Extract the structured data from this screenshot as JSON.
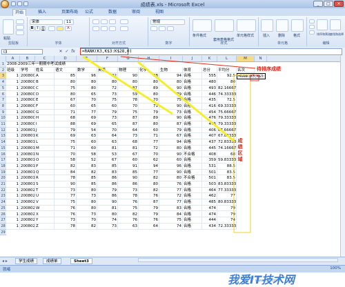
{
  "window": {
    "title": "成绩表.xls - Microsoft Excel"
  },
  "tabs": [
    "开始",
    "插入",
    "页面布局",
    "公式",
    "数据",
    "审阅",
    "视图"
  ],
  "ribbon": {
    "groups": [
      "剪贴板",
      "字体",
      "对齐方式",
      "数字",
      "样式",
      "单元格",
      "编辑"
    ],
    "buttons": [
      "粘贴",
      "条件格式",
      "套用表格格式",
      "单元格样式",
      "插入",
      "删除",
      "格式",
      "排序和筛选",
      "查找和选择"
    ],
    "font_name": "宋体",
    "font_size": "11",
    "number_format": "常规"
  },
  "formula_bar": {
    "name_box": "I3",
    "formula": "=RANK(K3,K$3:K$28,0)"
  },
  "columns": [
    "A",
    "B",
    "C",
    "D",
    "E",
    "F",
    "G",
    "H",
    "I",
    "J",
    "K",
    "L",
    "M",
    "N"
  ],
  "sheet": {
    "title": "2008-2009三年一期期中考试成绩",
    "headers": [
      "班级",
      "学号",
      "姓名",
      "语文",
      "数学",
      "英语",
      "物理",
      "化学",
      "生物",
      "体育",
      "总分",
      "平均分",
      "名次"
    ],
    "rows": [
      [
        "1",
        "2008001",
        "A",
        "85",
        "96",
        "92",
        "90",
        "98",
        "94",
        "合格",
        "555",
        "92.5",
        "=RANK(K3,K$3:K$28,0)"
      ],
      [
        "1",
        "2008002",
        "B",
        "80",
        "80",
        "80",
        "80",
        "80",
        "80",
        "合格",
        "480",
        "80",
        ""
      ],
      [
        "1",
        "2008003",
        "C",
        "75",
        "80",
        "72",
        "87",
        "89",
        "90",
        "合格",
        "493",
        "82.16667",
        ""
      ],
      [
        "1",
        "2008004",
        "D",
        "80",
        "65",
        "73",
        "59",
        "80",
        "79",
        "合格",
        "446",
        "74.33333",
        ""
      ],
      [
        "1",
        "2008005",
        "E",
        "67",
        "70",
        "75",
        "78",
        "70",
        "75",
        "合格",
        "435",
        "72.5",
        ""
      ],
      [
        "1",
        "2008006",
        "F",
        "60",
        "65",
        "60",
        "70",
        "71",
        "90",
        "合格",
        "416",
        "69.33333",
        ""
      ],
      [
        "1",
        "2008007",
        "G",
        "71",
        "77",
        "79",
        "75",
        "79",
        "73",
        "合格",
        "454",
        "75.66667",
        ""
      ],
      [
        "1",
        "2008008",
        "H",
        "68",
        "69",
        "73",
        "87",
        "89",
        "90",
        "合格",
        "476",
        "79.33333",
        ""
      ],
      [
        "1",
        "2008009",
        "I",
        "88",
        "69",
        "65",
        "87",
        "80",
        "87",
        "合格",
        "476",
        "79.33333",
        ""
      ],
      [
        "1",
        "2008010",
        "J",
        "79",
        "54",
        "70",
        "64",
        "60",
        "79",
        "合格",
        "406",
        "67.66667",
        ""
      ],
      [
        "1",
        "2008011",
        "K",
        "69",
        "63",
        "64",
        "73",
        "71",
        "67",
        "合格",
        "407",
        "67.83333",
        ""
      ],
      [
        "1",
        "2008012",
        "L",
        "75",
        "60",
        "63",
        "68",
        "77",
        "94",
        "合格",
        "437",
        "72.83333",
        ""
      ],
      [
        "1",
        "2008013",
        "M",
        "71",
        "60",
        "81",
        "81",
        "72",
        "80",
        "合格",
        "445",
        "74.16667",
        ""
      ],
      [
        "1",
        "2008014",
        "N",
        "70",
        "58",
        "53",
        "67",
        "70",
        "90",
        "不合格",
        "408",
        "68",
        ""
      ],
      [
        "1",
        "2008015",
        "O",
        "58",
        "52",
        "67",
        "60",
        "62",
        "60",
        "合格",
        "359",
        "59.83333",
        ""
      ],
      [
        "1",
        "2008016",
        "P",
        "82",
        "83",
        "85",
        "91",
        "94",
        "96",
        "合格",
        "531",
        "88.5",
        ""
      ],
      [
        "1",
        "2008017",
        "Q",
        "84",
        "82",
        "83",
        "85",
        "77",
        "90",
        "合格",
        "501",
        "83.5",
        ""
      ],
      [
        "1",
        "2008018",
        "R",
        "78",
        "85",
        "86",
        "90",
        "82",
        "80",
        "不合格",
        "501",
        "83.5",
        ""
      ],
      [
        "1",
        "2008019",
        "S",
        "90",
        "85",
        "86",
        "86",
        "80",
        "76",
        "合格",
        "503",
        "83.83333",
        ""
      ],
      [
        "1",
        "2008020",
        "T",
        "73",
        "80",
        "79",
        "73",
        "82",
        "77",
        "合格",
        "464",
        "77.33333",
        ""
      ],
      [
        "1",
        "2008021",
        "U",
        "77",
        "73",
        "86",
        "78",
        "76",
        "72",
        "合格",
        "462",
        "77",
        ""
      ],
      [
        "1",
        "2008022",
        "V",
        "75",
        "80",
        "90",
        "76",
        "87",
        "77",
        "合格",
        "485",
        "80.83333",
        ""
      ],
      [
        "1",
        "2008023",
        "W",
        "76",
        "80",
        "81",
        "75",
        "79",
        "83",
        "合格",
        "474",
        "79",
        ""
      ],
      [
        "1",
        "2008024",
        "X",
        "76",
        "73",
        "80",
        "82",
        "79",
        "84",
        "合格",
        "474",
        "79",
        ""
      ],
      [
        "1",
        "2008025",
        "Y",
        "73",
        "70",
        "74",
        "76",
        "76",
        "75",
        "合格",
        "444",
        "74",
        ""
      ],
      [
        "1",
        "2008026",
        "Z",
        "78",
        "82",
        "73",
        "63",
        "64",
        "74",
        "合格",
        "434",
        "72.33333",
        ""
      ]
    ]
  },
  "annotations": {
    "rank_label": "待排序成绩",
    "range_label": "成绩区域"
  },
  "sheet_tabs": [
    "学生成绩",
    "成绩单",
    "Sheet3"
  ],
  "status": {
    "ready": "就绪",
    "zoom": "100%"
  },
  "watermark": {
    "text": "我爱IT技术网",
    "url": "www.52ij.com"
  }
}
